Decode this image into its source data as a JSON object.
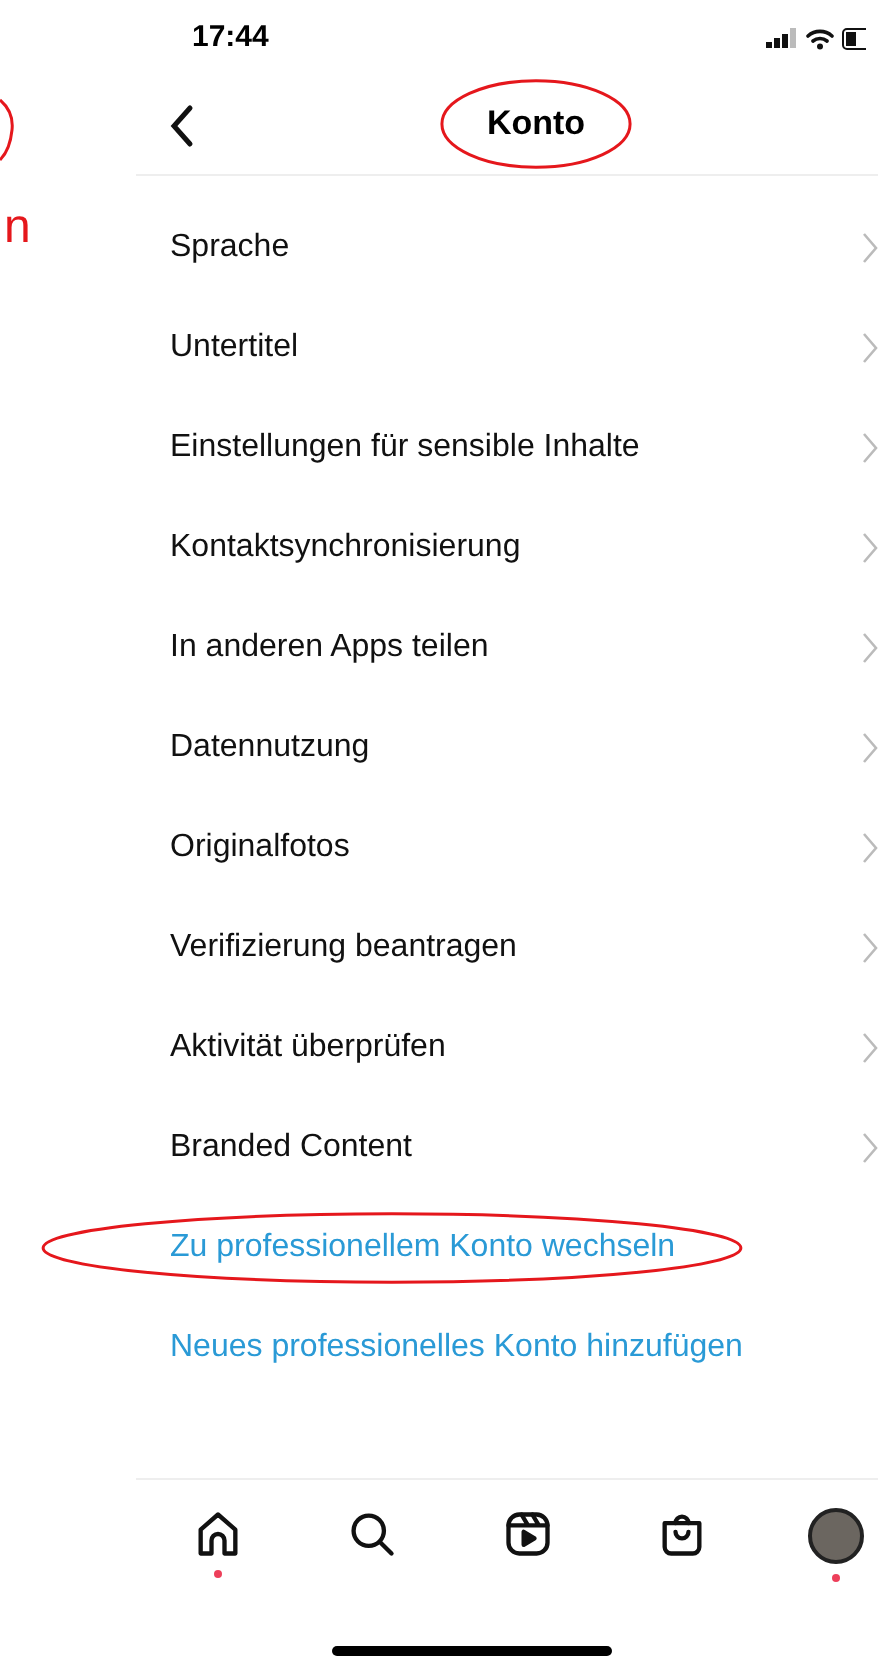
{
  "side_annotation": {
    "text": "n"
  },
  "status_bar": {
    "time": "17:44"
  },
  "header": {
    "title": "Konto",
    "circled": true
  },
  "menu_items": [
    {
      "label": "Sprache"
    },
    {
      "label": "Untertitel"
    },
    {
      "label": "Einstellungen für sensible Inhalte"
    },
    {
      "label": "Kontaktsynchronisierung"
    },
    {
      "label": "In anderen Apps teilen"
    },
    {
      "label": "Datennutzung"
    },
    {
      "label": "Originalfotos"
    },
    {
      "label": "Verifizierung beantragen"
    },
    {
      "label": "Aktivität überprüfen"
    },
    {
      "label": "Branded Content"
    }
  ],
  "links": [
    {
      "label": "Zu professionellem Konto wechseln",
      "circled": true
    },
    {
      "label": "Neues professionelles Konto hinzufügen",
      "circled": false
    }
  ],
  "tab_bar": [
    {
      "kind": "home",
      "dot": true
    },
    {
      "kind": "search",
      "dot": false
    },
    {
      "kind": "reels",
      "dot": false
    },
    {
      "kind": "shop",
      "dot": false
    },
    {
      "kind": "profile",
      "dot": true
    }
  ]
}
